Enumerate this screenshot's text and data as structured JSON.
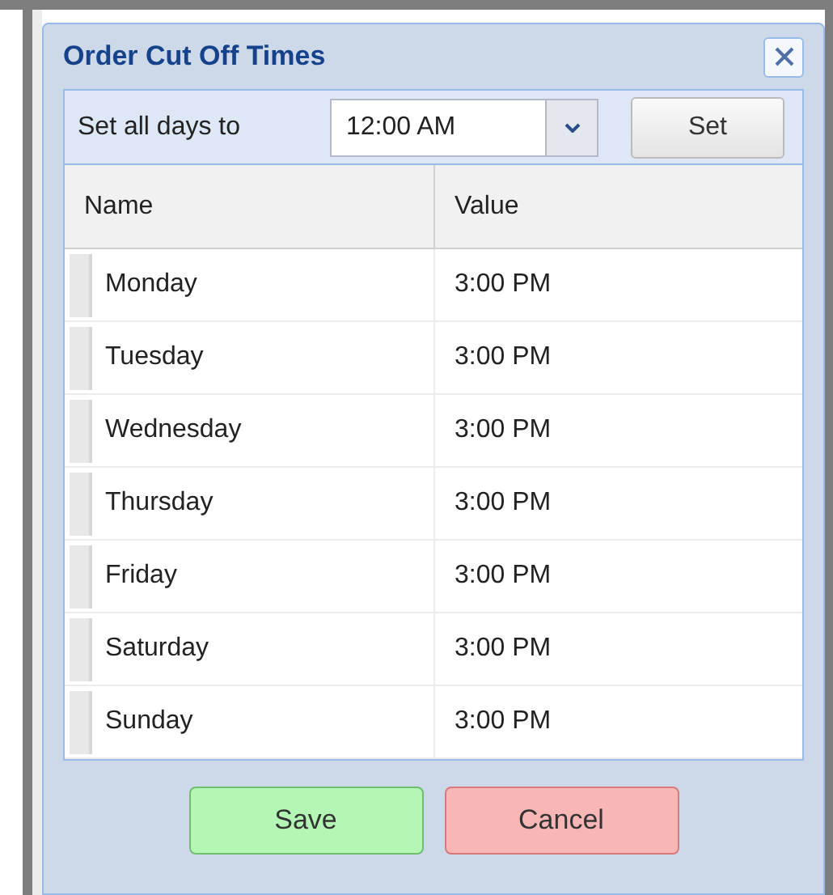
{
  "dialog": {
    "title": "Order Cut Off Times"
  },
  "toolbar": {
    "label": "Set all days to",
    "time_value": "12:00 AM",
    "set_button": "Set"
  },
  "table": {
    "columns": [
      "Name",
      "Value"
    ],
    "rows": [
      {
        "name": "Monday",
        "value": "3:00 PM"
      },
      {
        "name": "Tuesday",
        "value": "3:00 PM"
      },
      {
        "name": "Wednesday",
        "value": "3:00 PM"
      },
      {
        "name": "Thursday",
        "value": "3:00 PM"
      },
      {
        "name": "Friday",
        "value": "3:00 PM"
      },
      {
        "name": "Saturday",
        "value": "3:00 PM"
      },
      {
        "name": "Sunday",
        "value": "3:00 PM"
      }
    ]
  },
  "buttons": [
    {
      "label": "Save",
      "kind": "confirm"
    },
    {
      "label": "Cancel",
      "kind": "cancel"
    }
  ]
}
